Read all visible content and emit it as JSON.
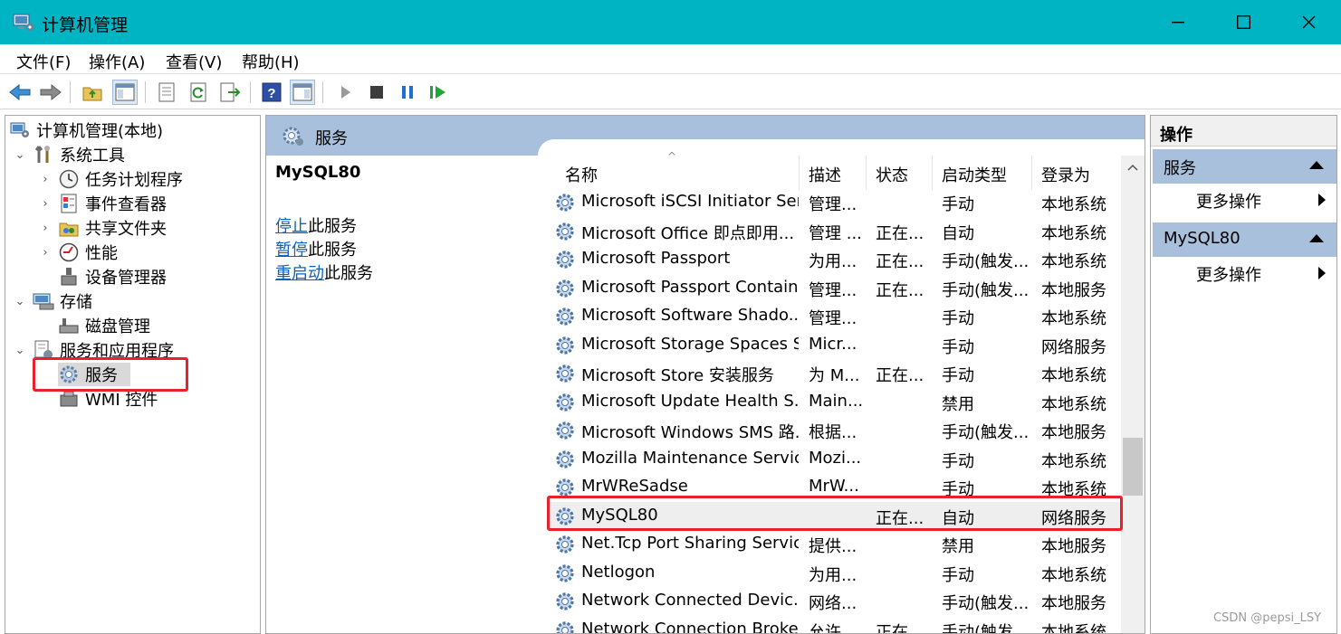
{
  "window": {
    "title": "计算机管理",
    "controls": {
      "minimize": "–",
      "maximize": "□",
      "close": "✕"
    }
  },
  "menu": [
    "文件(F)",
    "操作(A)",
    "查看(V)",
    "帮助(H)"
  ],
  "toolbar": {
    "icons": [
      "back-icon",
      "forward-icon",
      "up-folder-icon",
      "show-hide-tree-icon",
      "properties-icon",
      "refresh-icon",
      "export-icon",
      "help-icon",
      "show-hide-action-pane-icon",
      "start-service-icon",
      "stop-service-icon",
      "pause-service-icon",
      "restart-service-icon"
    ]
  },
  "tree": {
    "root": "计算机管理(本地)",
    "items": [
      {
        "label": "系统工具",
        "level": 1,
        "expander": "expanded"
      },
      {
        "label": "任务计划程序",
        "level": 2,
        "expander": "collapsed"
      },
      {
        "label": "事件查看器",
        "level": 2,
        "expander": "collapsed"
      },
      {
        "label": "共享文件夹",
        "level": 2,
        "expander": "collapsed"
      },
      {
        "label": "性能",
        "level": 2,
        "expander": "collapsed"
      },
      {
        "label": "设备管理器",
        "level": 2,
        "expander": "none"
      },
      {
        "label": "存储",
        "level": 1,
        "expander": "expanded"
      },
      {
        "label": "磁盘管理",
        "level": 2,
        "expander": "none"
      },
      {
        "label": "服务和应用程序",
        "level": 1,
        "expander": "expanded"
      },
      {
        "label": "服务",
        "level": 2,
        "expander": "none",
        "selected": true
      },
      {
        "label": "WMI 控件",
        "level": 2,
        "expander": "none"
      }
    ]
  },
  "services_panel": {
    "title": "服务",
    "selected_service": "MySQL80",
    "actions": [
      {
        "link": "停止",
        "rest": "此服务"
      },
      {
        "link": "暂停",
        "rest": "此服务"
      },
      {
        "link": "重启动",
        "rest": "此服务"
      }
    ],
    "columns": [
      "名称",
      "描述",
      "状态",
      "启动类型",
      "登录为"
    ],
    "rows": [
      {
        "name": "Microsoft iSCSI Initiator Ser...",
        "desc": "管理...",
        "status": "",
        "startup": "手动",
        "logon": "本地系统"
      },
      {
        "name": "Microsoft Office 即点即用...",
        "desc": "管理 ...",
        "status": "正在...",
        "startup": "自动",
        "logon": "本地系统"
      },
      {
        "name": "Microsoft Passport",
        "desc": "为用...",
        "status": "正在...",
        "startup": "手动(触发...",
        "logon": "本地系统"
      },
      {
        "name": "Microsoft Passport Container",
        "desc": "管理...",
        "status": "正在...",
        "startup": "手动(触发...",
        "logon": "本地服务"
      },
      {
        "name": "Microsoft Software Shado...",
        "desc": "管理...",
        "status": "",
        "startup": "手动",
        "logon": "本地系统"
      },
      {
        "name": "Microsoft Storage Spaces S...",
        "desc": "Micr...",
        "status": "",
        "startup": "手动",
        "logon": "网络服务"
      },
      {
        "name": "Microsoft Store 安装服务",
        "desc": "为 M...",
        "status": "正在...",
        "startup": "手动",
        "logon": "本地系统"
      },
      {
        "name": "Microsoft Update Health S...",
        "desc": "Main...",
        "status": "",
        "startup": "禁用",
        "logon": "本地系统"
      },
      {
        "name": "Microsoft Windows SMS 路...",
        "desc": "根据...",
        "status": "",
        "startup": "手动(触发...",
        "logon": "本地服务"
      },
      {
        "name": "Mozilla Maintenance Service",
        "desc": "Mozi...",
        "status": "",
        "startup": "手动",
        "logon": "本地系统"
      },
      {
        "name": "MrWReSadse",
        "desc": "MrW...",
        "status": "",
        "startup": "手动",
        "logon": "本地系统"
      },
      {
        "name": "MySQL80",
        "desc": "",
        "status": "正在...",
        "startup": "自动",
        "logon": "网络服务",
        "selected": true
      },
      {
        "name": "Net.Tcp Port Sharing Service",
        "desc": "提供...",
        "status": "",
        "startup": "禁用",
        "logon": "本地服务"
      },
      {
        "name": "Netlogon",
        "desc": "为用...",
        "status": "",
        "startup": "手动",
        "logon": "本地系统"
      },
      {
        "name": "Network Connected Devic...",
        "desc": "网络...",
        "status": "",
        "startup": "手动(触发...",
        "logon": "本地服务"
      },
      {
        "name": "Network Connection Broker",
        "desc": "允许 ...",
        "status": "正在...",
        "startup": "手动(触发...",
        "logon": "本地系统"
      }
    ]
  },
  "actions_pane": {
    "title": "操作",
    "groups": [
      {
        "label": "服务",
        "item": "更多操作"
      },
      {
        "label": "MySQL80",
        "item": "更多操作"
      }
    ]
  },
  "watermark": "CSDN @pepsi_LSY",
  "colors": {
    "titlebar": "#00b4c4",
    "header": "#a8c0dc",
    "highlight": "#e8222d",
    "link": "#0b61c4"
  }
}
